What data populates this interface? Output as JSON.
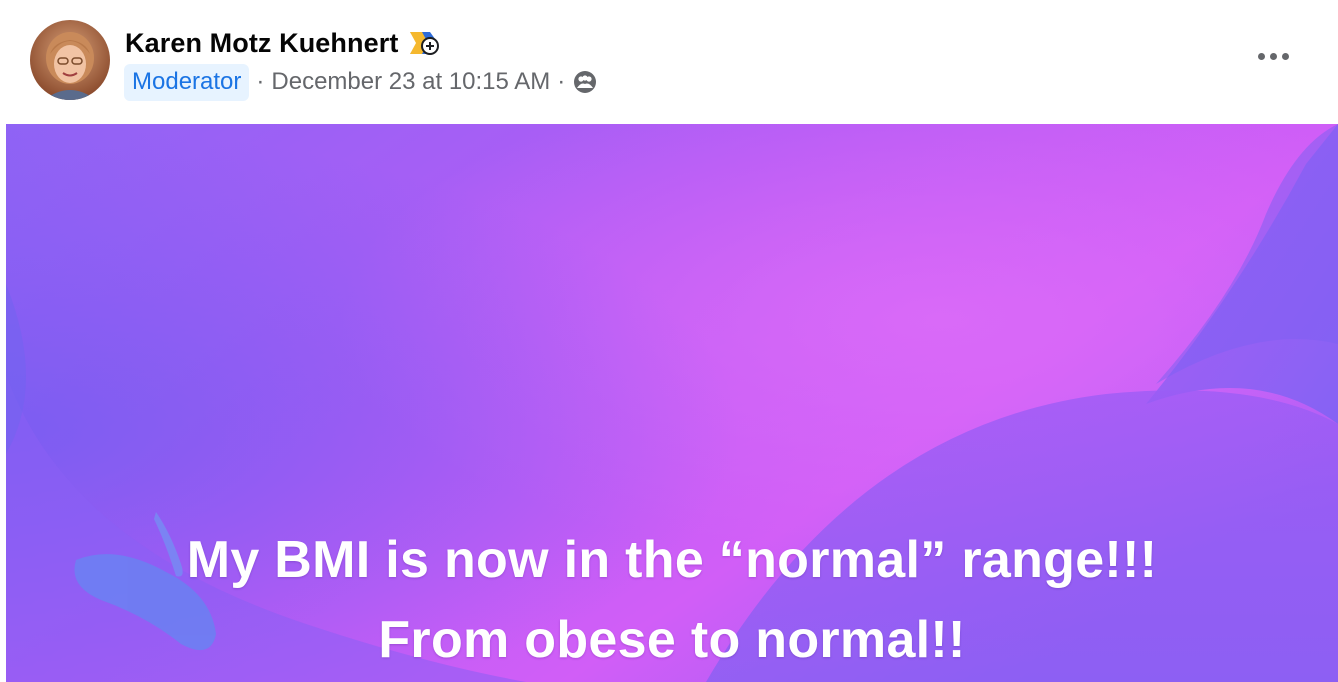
{
  "post": {
    "author_name": "Karen Motz Kuehnert",
    "author_badge_icon": "top-fan-badge-icon",
    "role_badge": "Moderator",
    "separator": "·",
    "timestamp": "December 23 at 10:15 AM",
    "privacy_icon": "group-privacy-icon",
    "more_icon": "more-options-icon",
    "text_line_1": "My BMI is now in the “normal” range!!!",
    "text_line_2": "From obese to normal!!"
  },
  "colors": {
    "background_primary": "#b25cf5",
    "background_secondary": "#8b5cf6",
    "role_badge_text": "#1b74e4",
    "role_badge_bg": "#e7f3ff",
    "secondary_text": "#65676b"
  }
}
